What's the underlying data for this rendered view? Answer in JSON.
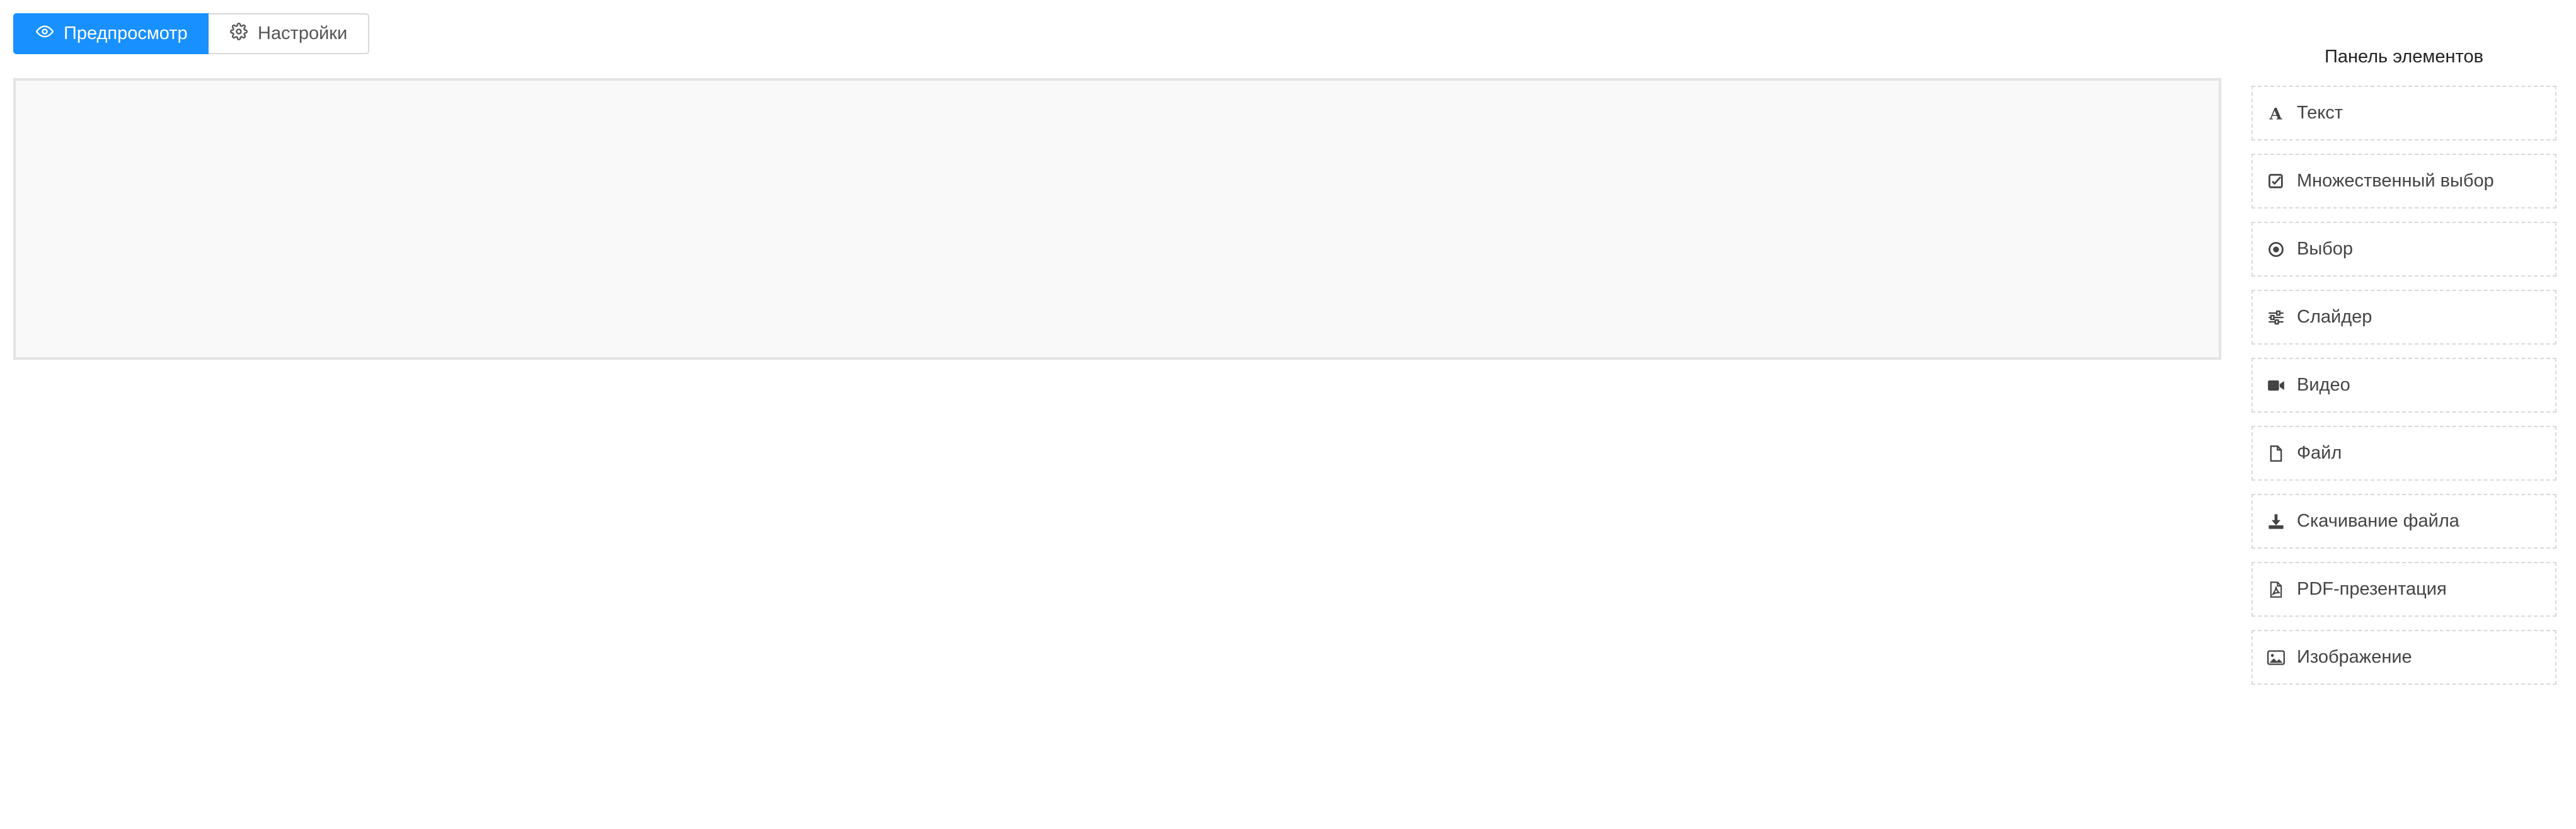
{
  "toolbar": {
    "preview_label": "Предпросмотр",
    "settings_label": "Настройки"
  },
  "panel": {
    "title": "Панель элементов",
    "items": [
      {
        "label": "Текст",
        "icon": "text-icon"
      },
      {
        "label": "Множественный выбор",
        "icon": "checkbox-icon"
      },
      {
        "label": "Выбор",
        "icon": "radio-icon"
      },
      {
        "label": "Слайдер",
        "icon": "sliders-icon"
      },
      {
        "label": "Видео",
        "icon": "video-icon"
      },
      {
        "label": "Файл",
        "icon": "file-icon"
      },
      {
        "label": "Скачивание файла",
        "icon": "download-icon"
      },
      {
        "label": "PDF-презентация",
        "icon": "pdf-file-icon"
      },
      {
        "label": "Изображение",
        "icon": "image-icon"
      }
    ]
  },
  "colors": {
    "primary": "#1890ff",
    "canvas_bg": "#f9f9f9",
    "border": "#d9d9d9"
  }
}
